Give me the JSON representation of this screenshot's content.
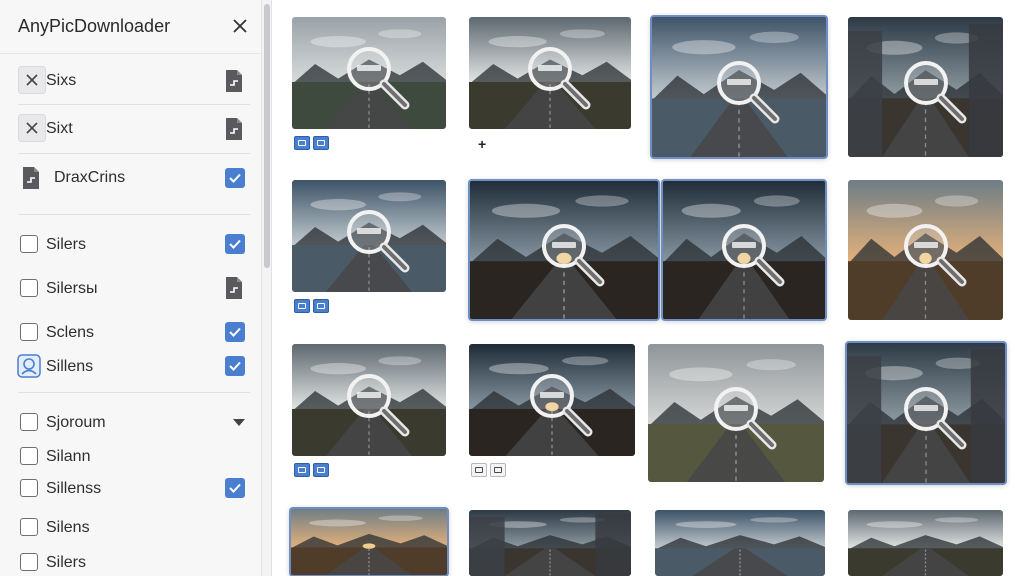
{
  "app": {
    "title": "AnyPicDownloader"
  },
  "sidebar": {
    "top_items": [
      {
        "label": "Sixs"
      },
      {
        "label": "Sixt"
      },
      {
        "label": "DraxCrins"
      }
    ],
    "filters_a": [
      {
        "label": "Silers",
        "checked": true
      },
      {
        "label": "Silersы",
        "checked": false
      },
      {
        "label": "Sclens",
        "checked": true
      },
      {
        "label": "Sillens",
        "checked": true
      }
    ],
    "filters_b": [
      {
        "label": "Sjoroum"
      },
      {
        "label": "Silann",
        "checked": false
      },
      {
        "label": "Sillenss",
        "checked": true
      },
      {
        "label": "Silens",
        "checked": false
      },
      {
        "label": "Silers",
        "checked": false
      }
    ]
  },
  "colors": {
    "accent": "#4a7fd0",
    "selection": "#6f8fc4"
  },
  "gallery": {
    "tile_count": 16,
    "extra_marker": "+"
  }
}
